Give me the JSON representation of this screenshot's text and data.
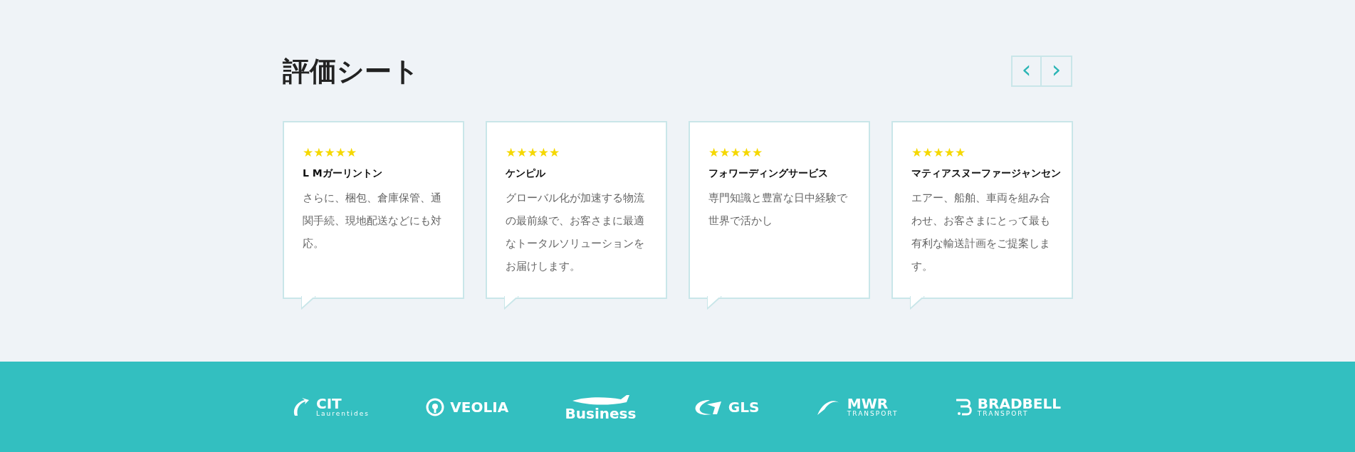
{
  "section": {
    "title": "評価シート"
  },
  "nav_buttons": [
    {
      "label": "‹"
    },
    {
      "label": "›"
    }
  ],
  "reviews": [
    {
      "stars": 5,
      "name": "L Mガーリントン",
      "text": "さらに、梱包、倉庫保管、通関手続、現地配送などにも対応。"
    },
    {
      "stars": 5,
      "name": "ケンピル",
      "text": "グローバル化が加速する物流の最前線で、お客さまに最適なトータルソリューションをお届けします。"
    },
    {
      "stars": 5,
      "name": "フォワーディングサービス",
      "text": "専門知識と豊富な日中経験で世界で活かし"
    },
    {
      "stars": 5,
      "name": "マティアスヌーファージャンセン",
      "text": "エアー、船舶、車両を組み合わせ、お客さまにとって最も有利な輸送計画をご提案します。"
    }
  ],
  "partners": [
    {
      "kind": "cit",
      "name": "CIT",
      "sub": "Laurentides"
    },
    {
      "kind": "veolia",
      "name": "VEOLIA"
    },
    {
      "kind": "business",
      "name": "Business"
    },
    {
      "kind": "gls",
      "name": "GLS"
    },
    {
      "kind": "mwr",
      "name": "MWR",
      "sub": "TRANSPORT"
    },
    {
      "kind": "bradbell",
      "name": "BRADBELL",
      "sub": "TRANSPORT"
    }
  ]
}
